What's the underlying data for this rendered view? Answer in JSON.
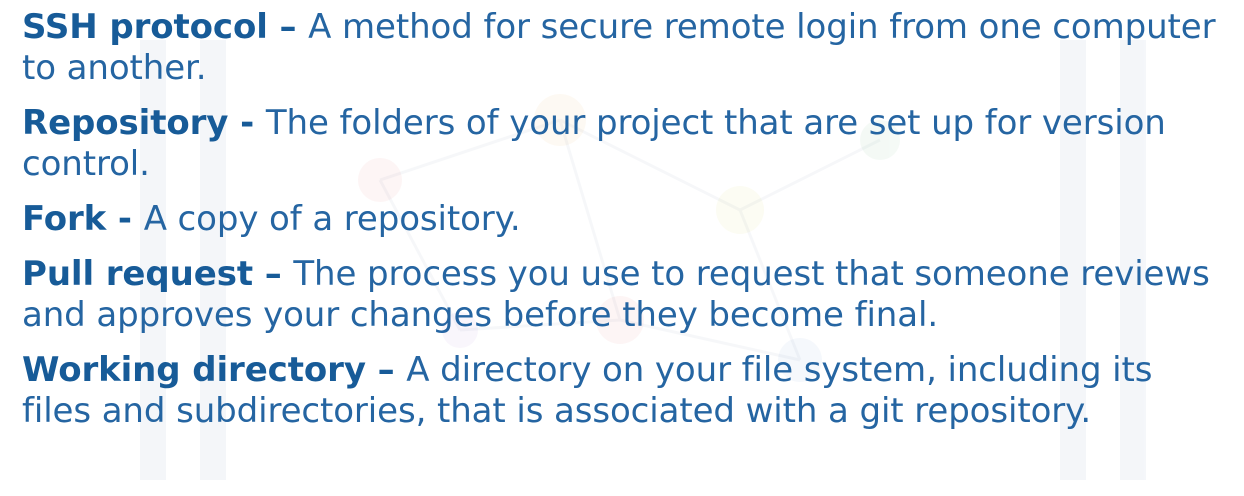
{
  "glossary": [
    {
      "term": "SSH protocol",
      "separator": " – ",
      "definition": "A method for secure remote login from one computer to another."
    },
    {
      "term": "Repository",
      "separator": " - ",
      "definition": "The folders of your project that are set up for version control."
    },
    {
      "term": "Fork",
      "separator": " - ",
      "definition": "A copy of a repository."
    },
    {
      "term": "Pull request",
      "separator": " – ",
      "definition": "The process you use to request that someone reviews and approves your changes before they become final."
    },
    {
      "term": "Working directory",
      "separator": " – ",
      "definition": "A directory on your file system, including its files and subdirectories, that is associated with a git repository."
    }
  ],
  "colors": {
    "text": "#1f5f9a",
    "background": "#ffffff"
  }
}
